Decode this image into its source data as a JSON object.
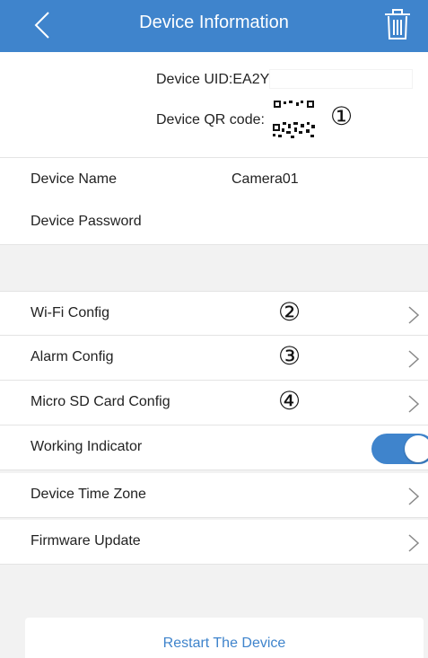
{
  "header": {
    "title": "Device Information",
    "back_icon": "chevron-left-icon",
    "trash_icon": "trash-icon",
    "background": "#3f84cc"
  },
  "device": {
    "uid_label": "Device UID:EA2Y",
    "uid_value": "",
    "qr_label": "Device QR code:"
  },
  "markers": [
    "①",
    "②",
    "③",
    "④"
  ],
  "settings": {
    "device_name_label": "Device Name",
    "device_name_value": "Camera01",
    "device_password_label": "Device Password",
    "wifi_config": "Wi-Fi Config",
    "alarm_config": "Alarm Config",
    "sd_card_config": "Micro SD Card Config",
    "working_indicator": "Working Indicator",
    "working_indicator_on": true,
    "device_time_zone": "Device Time Zone",
    "firmware_update": "Firmware Update"
  },
  "restart_button": "Restart The Device",
  "accent_color": "#3f84cc"
}
